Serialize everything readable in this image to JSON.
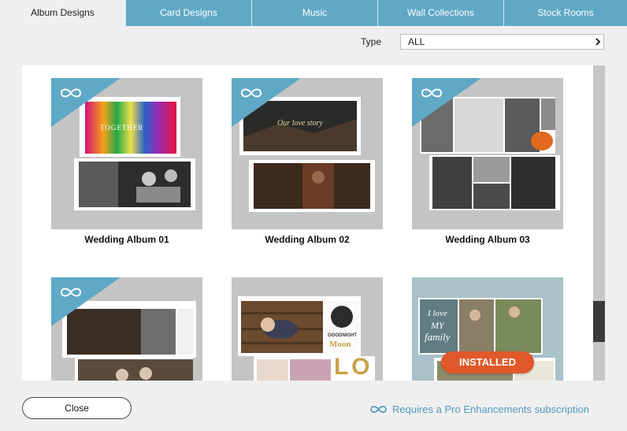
{
  "tabs": [
    {
      "label": "Album Designs",
      "active": true
    },
    {
      "label": "Card Designs",
      "active": false
    },
    {
      "label": "Music",
      "active": false
    },
    {
      "label": "Wall Collections",
      "active": false
    },
    {
      "label": "Stock Rooms",
      "active": false
    }
  ],
  "filter": {
    "label": "Type",
    "value": "ALL"
  },
  "designs": [
    {
      "title": "Wedding Album 01",
      "pro": true,
      "installed": false
    },
    {
      "title": "Wedding Album 02",
      "pro": true,
      "installed": false
    },
    {
      "title": "Wedding Album 03",
      "pro": true,
      "installed": false
    },
    {
      "title": "",
      "pro": true,
      "installed": false
    },
    {
      "title": "",
      "pro": false,
      "installed": false
    },
    {
      "title": "",
      "pro": false,
      "installed": true,
      "installed_label": "INSTALLED"
    }
  ],
  "photo_text": {
    "album1_spread": "TOGETHER",
    "album2_script": "Our love story",
    "card5_goodnight": "GOODNIGHT",
    "card5_moon": "Moon",
    "card5_letters": "L O",
    "card6_script_1": "I love",
    "card6_script_2": "MY",
    "card6_script_3": "family"
  },
  "footer": {
    "close_label": "Close",
    "pro_note": "Requires a Pro Enhancements subscription"
  },
  "colors": {
    "accent": "#5fa8c6",
    "installed": "#e0582a",
    "pro_text": "#4f9bbd"
  },
  "icons": {
    "pro_badge": "infinity-icon",
    "dropdown": "chevron-right-icon"
  }
}
